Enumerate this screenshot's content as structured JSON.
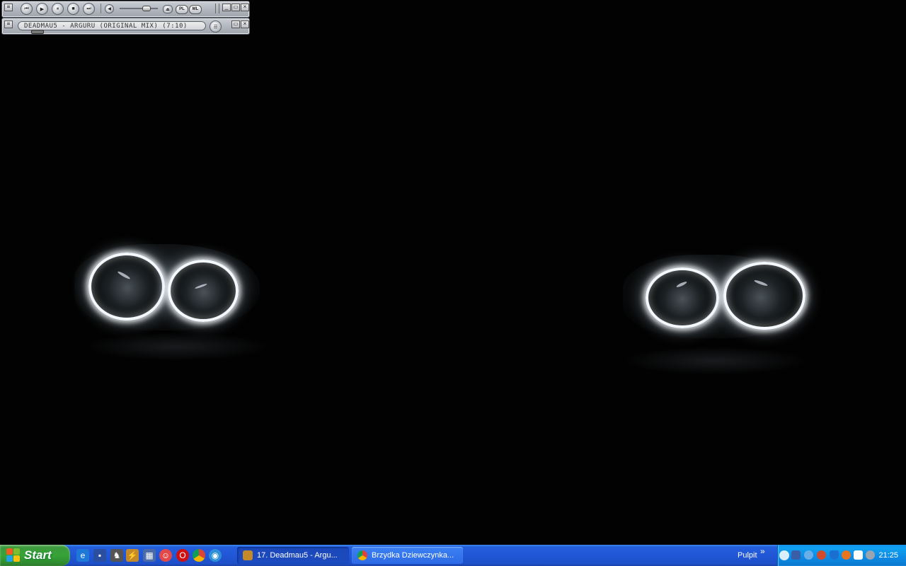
{
  "winamp": {
    "title_scroll": "DEADMAU5 - ARGURU (ORIGINAL MIX) (7:10)",
    "buttons": {
      "prev": "⏮",
      "play": "▶",
      "pause": "⏸",
      "stop": "■",
      "next": "⏭",
      "eject": "⏏"
    },
    "pl_label": "PL",
    "ml_label": "ML",
    "volume_level": 0.72,
    "seek_position": 0.06
  },
  "taskbar": {
    "start_label": "Start",
    "quick_launch": [
      "ie-icon",
      "save-icon",
      "media-icon",
      "winamp-icon",
      "network-icon",
      "game-icon",
      "opera-icon",
      "chrome-icon",
      "earth-icon"
    ],
    "tasks": [
      {
        "label": "17. Deadmau5 - Argu...",
        "icon": "winamp-icon",
        "active": true
      },
      {
        "label": "Brzydka Dziewczynka...",
        "icon": "chrome-icon",
        "active": false
      }
    ],
    "desktop_toolbar": "Pulpit",
    "clock": "21:25",
    "tray_icons": [
      "back-arrow-icon",
      "network-icon",
      "update-icon",
      "settings-icon",
      "shield-icon",
      "firefox-icon",
      "mail-icon",
      "speaker-icon"
    ]
  },
  "colors": {
    "taskbar_blue": "#245edb",
    "start_green": "#37a337",
    "tray_blue": "#0f8fea",
    "winamp_silver": "#b5b9c1"
  }
}
